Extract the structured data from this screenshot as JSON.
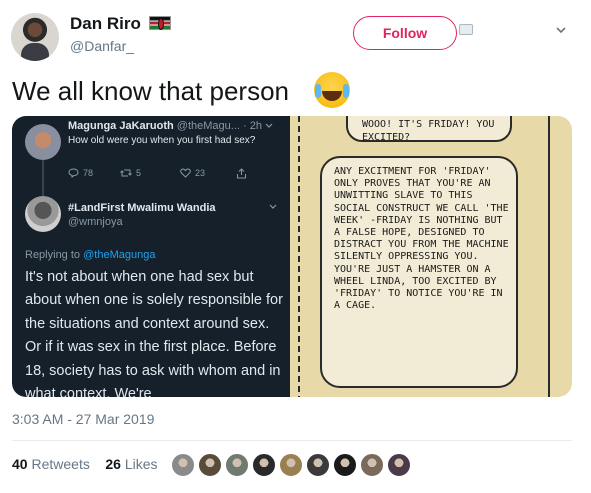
{
  "user": {
    "display_name": "Dan Riro",
    "handle": "@Danfar_",
    "flag": "kenya-flag"
  },
  "follow_button": {
    "label": "Follow",
    "color": "#e0245e"
  },
  "tweet": {
    "text": "We all know that person",
    "emoji": "face-with-tears-of-joy",
    "timestamp": "3:03 AM - 27 Mar 2019",
    "retweet_count": "40",
    "retweet_label": "Retweets",
    "like_count": "26",
    "like_label": "Likes"
  },
  "media": {
    "quoted": {
      "name": "Magunga JaKaruoth",
      "meta": "@theMagu... · 2h",
      "text": "How old were you when you first had sex?",
      "replies": "78",
      "retweets": "5",
      "likes": "23"
    },
    "reply": {
      "name": "#LandFirst Mwalimu Wandia",
      "handle": "@wmnjoya",
      "replying_prefix": "Replying to",
      "replying_to": "@theMagunga",
      "text": "It's not about when one had sex but about when one is solely responsible for the situations and context around sex. Or if it was sex in the first place. Before 18, society has to ask with whom and in what context. We're"
    },
    "comic": {
      "top_bubble": "Wooo! It's Friday! You excited?",
      "main_bubble": "Any excitment for 'Friday' only proves that you're an unwitting slave to this social construct we call 'the week' -Friday is nothing but a false hope, designed to distract you from the machine silently oppressing you. You're just a hamster on a wheel Linda, too excited by 'Friday' to notice you're in a cage."
    }
  },
  "likers": [
    "#8a8a8a",
    "#5a4a3a",
    "#6f7a70",
    "#2a2a2a",
    "#9a8050",
    "#3a3a3a",
    "#1a1a1a",
    "#7a6a5a",
    "#4a3a4a"
  ],
  "colors": {
    "accent": "#e0245e",
    "link": "#1da1f2",
    "muted": "#657786"
  }
}
